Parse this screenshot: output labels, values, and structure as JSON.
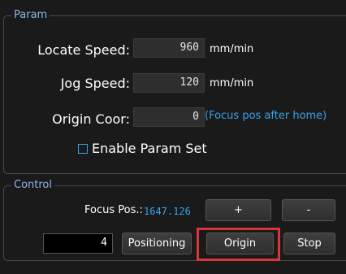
{
  "param": {
    "legend": "Param",
    "locate_speed": {
      "label": "Locate Speed:",
      "value": "960",
      "unit": "mm/min"
    },
    "jog_speed": {
      "label": "Jog Speed:",
      "value": "120",
      "unit": "mm/min"
    },
    "origin_coor": {
      "label": "Origin Coor:",
      "value": "0",
      "hint": "(Focus pos after home)"
    },
    "enable_param_set": {
      "label": "Enable Param Set",
      "checked": false
    }
  },
  "control": {
    "legend": "Control",
    "focus_pos_label": "Focus Pos.:",
    "focus_pos_value": "1647.126",
    "plus_label": "+",
    "minus_label": "-",
    "step_value": "4",
    "positioning_label": "Positioning",
    "origin_label": "Origin",
    "stop_label": "Stop"
  },
  "colors": {
    "background": "#1a1a1a",
    "legend": "#8eb6ea",
    "accent": "#3ba3ea",
    "highlight": "#d9363a"
  }
}
